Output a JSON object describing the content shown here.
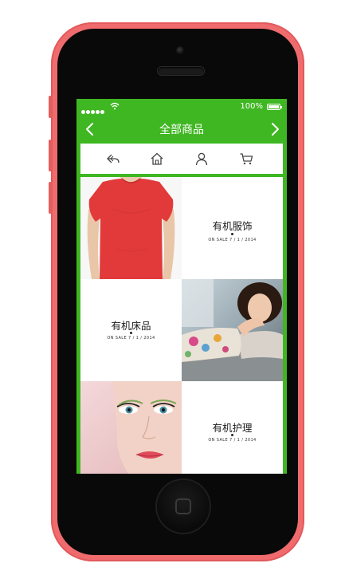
{
  "status_bar": {
    "battery": "100%",
    "signal_icon": "signal-dots-icon",
    "wifi_icon": "wifi-icon",
    "battery_icon": "battery-icon"
  },
  "header": {
    "title": "全部商品",
    "back_icon": "chevron-left-icon",
    "forward_icon": "chevron-right-icon",
    "accent_color": "#3fb722"
  },
  "toolbar": {
    "items": [
      {
        "icon": "back-arrow-icon"
      },
      {
        "icon": "home-icon"
      },
      {
        "icon": "user-icon"
      },
      {
        "icon": "cart-icon"
      }
    ]
  },
  "products": [
    {
      "title": "有机服饰",
      "meta": "ON SALE  7 / 1 / 2014",
      "image": "red-tshirt"
    },
    {
      "title": "有机床品",
      "meta": "ON SALE  7 / 1 / 2014",
      "image": "woman-on-bed"
    },
    {
      "title": "有机护理",
      "meta": "ON SALE  7 / 1 / 2014",
      "image": "beauty-face"
    }
  ]
}
